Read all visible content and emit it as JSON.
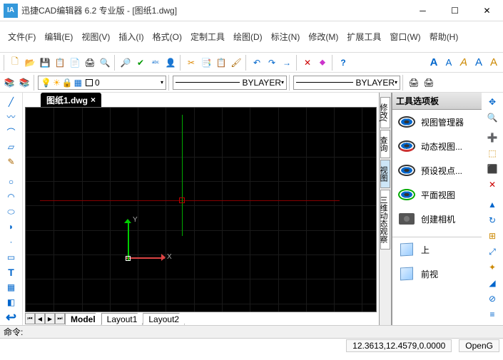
{
  "title": "迅捷CAD编辑器 6.2 专业版  - [图纸1.dwg]",
  "menu": [
    "文件(F)",
    "编辑(E)",
    "视图(V)",
    "插入(I)",
    "格式(O)",
    "定制工具",
    "绘图(D)",
    "标注(N)",
    "修改(M)",
    "扩展工具",
    "窗口(W)",
    "帮助(H)"
  ],
  "layer_val": "0",
  "linetype": "BYLAYER",
  "lineweight": "BYLAYER",
  "doc_tab": "图纸1.dwg",
  "axis": {
    "x": "X",
    "y": "Y"
  },
  "layout": {
    "model": "Model",
    "l1": "Layout1",
    "l2": "Layout2"
  },
  "vpanels": {
    "modify": "修改(",
    "query": "查询",
    "view": "视图",
    "dyn": "三维动态观察"
  },
  "palette_title": "工具选项板",
  "palette_items": {
    "view_mgr": "视图管理器",
    "dyn_view": "动态视图...",
    "preset": "预设视点...",
    "plan": "平面视图",
    "camera": "创建相机",
    "up": "上",
    "front": "前视"
  },
  "cmd_prompt": "命令:",
  "coords": "12.3613,12.4579,0.0000",
  "render": "OpenG",
  "icons": {
    "new": "🗋",
    "open": "📂",
    "save": "💾",
    "copy": "📋",
    "paste": "📄",
    "print": "🖨",
    "preview": "🔍",
    "find": "🔎",
    "doc": "📄",
    "check": "✔",
    "spell": "ᵃᵇᶜ",
    "person": "👤",
    "cut": "✂",
    "copy2": "📑",
    "paste2": "📋",
    "brush": "🖌",
    "undo": "↶",
    "redo": "↷",
    "fwd": "→",
    "del": "✕",
    "dim": "⬥",
    "help": "?",
    "font_a": "A",
    "font_b": "A",
    "font_c": "A",
    "font_d": "A",
    "font_e": "A",
    "layers": "📚",
    "layers2": "📚",
    "bulb": "💡",
    "sun": "☀",
    "lock": "🔒",
    "block": "▦",
    "l_line": "╱",
    "l_spline": "〰",
    "l_arc": "⌒",
    "l_poly": "▱",
    "l_free": "✎",
    "l_circ": "○",
    "l_arc2": "◠",
    "l_ell": "⬭",
    "l_earc": "◗",
    "l_pt": "·",
    "l_rect": "▭",
    "l_more": "▽",
    "text": "T",
    "l_hatch": "▦",
    "l_reg": "◧",
    "l_back": "↩",
    "r_pan": "✥",
    "r_zoom": "🔍",
    "r_zin": "➕",
    "r_sel": "⬚",
    "r_sel2": "⬛",
    "r_del": "✕",
    "r_mir": "▲",
    "r_rot": "↻",
    "r_arr": "⊞",
    "r_scl": "⤢",
    "r_exp": "✦",
    "r_cham": "◢",
    "r_bool": "⊘",
    "r_brk": "≡",
    "r_print": "🖨"
  }
}
